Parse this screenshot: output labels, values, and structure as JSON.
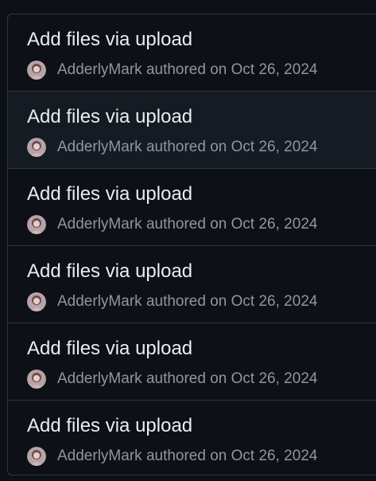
{
  "commits": [
    {
      "title": "Add files via upload",
      "author": "AdderlyMark",
      "verb": "authored",
      "date_prefix": "on",
      "date": "Oct 26, 2024"
    },
    {
      "title": "Add files via upload",
      "author": "AdderlyMark",
      "verb": "authored",
      "date_prefix": "on",
      "date": "Oct 26, 2024"
    },
    {
      "title": "Add files via upload",
      "author": "AdderlyMark",
      "verb": "authored",
      "date_prefix": "on",
      "date": "Oct 26, 2024"
    },
    {
      "title": "Add files via upload",
      "author": "AdderlyMark",
      "verb": "authored",
      "date_prefix": "on",
      "date": "Oct 26, 2024"
    },
    {
      "title": "Add files via upload",
      "author": "AdderlyMark",
      "verb": "authored",
      "date_prefix": "on",
      "date": "Oct 26, 2024"
    },
    {
      "title": "Add files via upload",
      "author": "AdderlyMark",
      "verb": "authored",
      "date_prefix": "on",
      "date": "Oct 26, 2024"
    }
  ],
  "colors": {
    "background": "#0d1117",
    "border": "#30363d",
    "hover_row": "#151b23",
    "title": "#e6edf3",
    "muted": "#8d96a0"
  }
}
